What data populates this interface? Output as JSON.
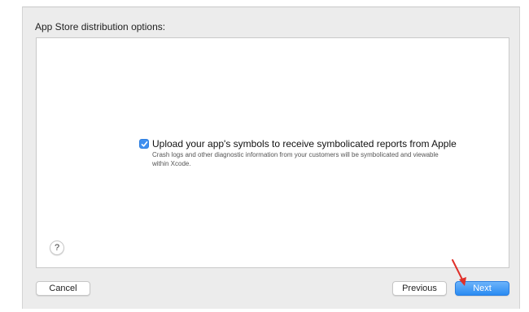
{
  "section": {
    "title": "App Store distribution options:"
  },
  "option": {
    "checked": true,
    "label": "Upload your app's symbols to receive symbolicated reports from Apple",
    "description": "Crash logs and other diagnostic information from your customers will be symbolicated and viewable within Xcode."
  },
  "help": {
    "label": "?"
  },
  "footer": {
    "cancel_label": "Cancel",
    "previous_label": "Previous",
    "next_label": "Next"
  },
  "colors": {
    "accent": "#3f8ff0",
    "annotation_arrow": "#e0302a"
  },
  "icons": {
    "checkbox": "checkmark-icon",
    "help": "question-mark-icon",
    "annotation": "red-arrow-icon"
  }
}
